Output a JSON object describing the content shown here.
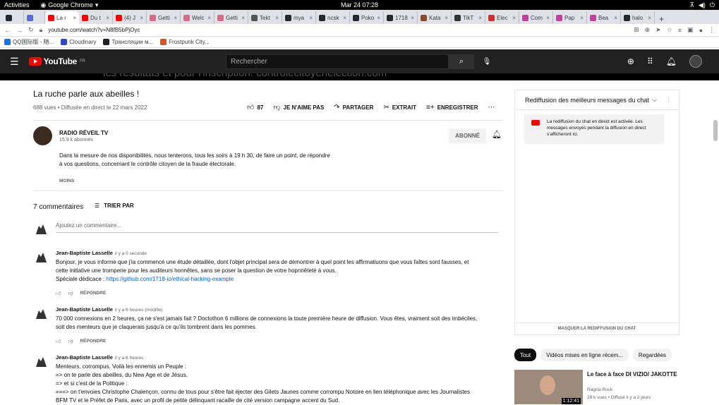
{
  "gnome": {
    "activities": "Activities",
    "app": "Google Chrome",
    "clock": "Mar 24  07:28"
  },
  "tabs": [
    {
      "label": "",
      "color": "#24292e"
    },
    {
      "label": "",
      "color": "#5b6bd5"
    },
    {
      "label": "La r",
      "color": "#ff0000",
      "active": true
    },
    {
      "label": "Du t",
      "color": "#ff0000"
    },
    {
      "label": "(4) J",
      "color": "#ff0000"
    },
    {
      "label": "Getti",
      "color": "#d86a8a"
    },
    {
      "label": "Welc",
      "color": "#d86a8a"
    },
    {
      "label": "Getti",
      "color": "#d86a8a"
    },
    {
      "label": "Tekt",
      "color": "#555555"
    },
    {
      "label": "mya",
      "color": "#24292e"
    },
    {
      "label": "ncsk",
      "color": "#24292e"
    },
    {
      "label": "Poko",
      "color": "#24292e"
    },
    {
      "label": "1718",
      "color": "#24292e"
    },
    {
      "label": "Kata",
      "color": "#8a4a2a"
    },
    {
      "label": "TikT",
      "color": "#333333"
    },
    {
      "label": "Elec",
      "color": "#d03030"
    },
    {
      "label": "Com",
      "color": "#c040a0"
    },
    {
      "label": "Pap",
      "color": "#c040a0"
    },
    {
      "label": "Bea",
      "color": "#c040a0"
    },
    {
      "label": "halo",
      "color": "#24292e"
    }
  ],
  "omnibox": {
    "url": "youtube.com/watch?v=N8fB5bPjOyc"
  },
  "bookmarks": [
    {
      "label": "QQ国际版 - 随...",
      "color": "#1a73e8"
    },
    {
      "label": "Cloudinary",
      "color": "#3448c5"
    },
    {
      "label": "Трансляции м...",
      "color": "#202124"
    },
    {
      "label": "Frostpunk City...",
      "color": "#e05020"
    }
  ],
  "yt": {
    "logo": "YouTube",
    "region": "FR",
    "search_placeholder": "Rechercher",
    "banner_text": "les résultats et pour l'inscription: controlecitoyenelection.com"
  },
  "video": {
    "title": "La ruche parle aux abeilles !",
    "meta": "688 vues • Diffusée en direct le 22 mars 2022",
    "likes": "87",
    "dislike": "JE N'AIME PAS",
    "share": "PARTAGER",
    "clip": "EXTRAIT",
    "save": "ENREGISTRER"
  },
  "channel": {
    "name": "RADIO RÉVEIL TV",
    "subs": "15,9 k abonnés",
    "subscribe": "ABONNÉ",
    "description": "Dans la mesure de nos disponibilités, nous tenterons, tous les soirs à 19 h 30, de faire un point, de répondre à vos questions, concernant le contrôle citoyen de la fraude électorale.",
    "less": "MOINS"
  },
  "comments_header": {
    "count": "7 commentaires",
    "sort": "TRIER PAR",
    "add_placeholder": "Ajoutez un commentaire..."
  },
  "comments": [
    {
      "author": "Jean-Baptiste Lasselle",
      "time": "il y a 0 seconde",
      "line1": "Bonjour, je vous informe que j'ia commencé une étude détaillée, dont l'objet principal sera de démontrer à quel point les affirmatiuons que vous faîtes sont fausses, et",
      "line2": "cette initiative une tromperie pour les auditeurs honnêtes, sans se poser la question de votre hopnnêteté à vous.",
      "line3": "Spéciale dédicace : ",
      "link": "https://github.com/1718-io/ethical-hacking-example",
      "reply": "RÉPONDRE"
    },
    {
      "author": "Jean-Baptiste Lasselle",
      "time": "il y a 6 heures (modifié)",
      "line1": "70 000 connexions en 2 heures, ça ne s'est jamais fait ? Doctothon 6 millions de connexions la toute première heure de diffusion. Vous êtes, vraiment  soit des imbéciles,",
      "line2": "soit des menteurs que je claquerais jusqu'à ce qu'ils tombrent dans les pommes.",
      "reply": "RÉPONDRE"
    },
    {
      "author": "Jean-Baptiste Lasselle",
      "time": "il y a 6 heures",
      "line1": "Menteurs, corrompus. Voilà les ennemis un Peuple :",
      "line2": "=> on te parle des abeilles, du New Age et de Jésus,",
      "line3": "=> et si c'est de la Politique :",
      "line4": "===> on t'envoies Christophe Chalençon, connu de tous pour s'être fait éjecter des Gilets Jaunes comme corrompu Notoire en lien téléphonique avec les Journalistes",
      "line5": "BFM TV et le Préfet de Paris, avec un profil de petite délinquant  racaille de cité version campagne  accent du Sud."
    }
  ],
  "chat": {
    "header": "Rediffusion des meilleurs messages du chat",
    "message": "La rediffusion du chat en direct est activée. Les messages envoyés pendant la diffusion en direct s'afficheront ici.",
    "footer": "MASQUER LA REDIFFUSION DU CHAT"
  },
  "chips": [
    "Tout",
    "Vidéos mises en ligne récem...",
    "Regardées"
  ],
  "recommendation": {
    "title": "Le face à face DI VIZIO/ JAKOTTE",
    "channel": "Ragna-Rock",
    "meta": "29 k vues • Diffusé il y a 2 jours",
    "duration": "1:12:41"
  }
}
